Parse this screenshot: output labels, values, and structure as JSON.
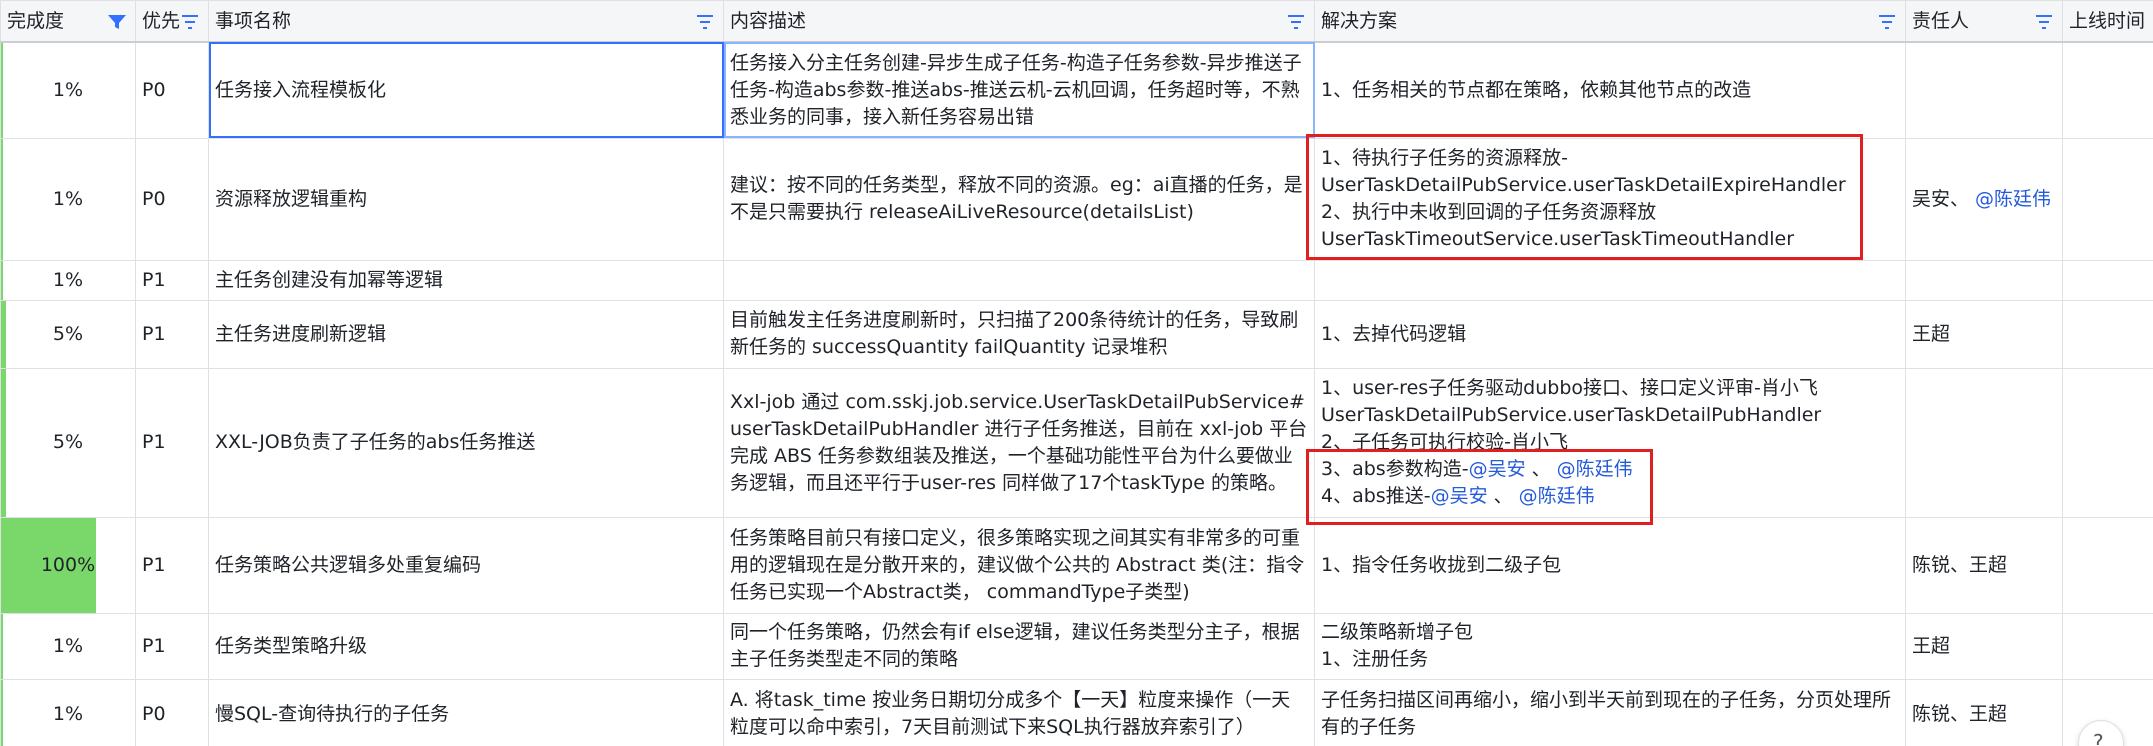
{
  "columns": [
    {
      "label": "完成度",
      "filter": true,
      "active": true
    },
    {
      "label": "优先",
      "filter": true
    },
    {
      "label": "事项名称",
      "filter": true
    },
    {
      "label": "内容描述",
      "filter": true
    },
    {
      "label": "解决方案",
      "filter": true
    },
    {
      "label": "责任人",
      "filter": true
    },
    {
      "label": "上线时间",
      "filter": false
    }
  ],
  "rows": [
    {
      "progress": "1%",
      "progress_value": 0.01,
      "priority": "P0",
      "name": "任务接入流程模板化",
      "desc": "任务接入分主任务创建-异步生成子任务-构造子任务参数-异步推送子任务-构造abs参数-推送abs-推送云机-云机回调，任务超时等，不熟悉业务的同事，接入新任务容易出错",
      "solution": [
        "1、任务相关的节点都在策略，依赖其他节点的改造"
      ],
      "owner": []
    },
    {
      "progress": "1%",
      "progress_value": 0.01,
      "priority": "P0",
      "name": "资源释放逻辑重构",
      "desc": "建议：按不同的任务类型，释放不同的资源。eg：ai直播的任务，是不是只需要执行 releaseAiLiveResource(detailsList)",
      "solution": [
        "1、待执行子任务的资源释放-",
        "UserTaskDetailPubService.userTaskDetailExpireHandler",
        "2、执行中未收到回调的子任务资源释放",
        "UserTaskTimeoutService.userTaskTimeoutHandler"
      ],
      "owner": [
        "吴安、",
        "@陈廷伟"
      ]
    },
    {
      "progress": "1%",
      "progress_value": 0.01,
      "priority": "P1",
      "name": "主任务创建没有加幂等逻辑",
      "desc": "",
      "solution": [],
      "owner": []
    },
    {
      "progress": "5%",
      "progress_value": 0.05,
      "priority": "P1",
      "name": "主任务进度刷新逻辑",
      "desc": "目前触发主任务进度刷新时，只扫描了200条待统计的任务，导致刷新任务的 successQuantity  failQuantity 记录堆积",
      "solution": [
        "1、去掉代码逻辑"
      ],
      "owner": [
        "王超"
      ]
    },
    {
      "progress": "5%",
      "progress_value": 0.05,
      "priority": "P1",
      "name": "XXL-JOB负责了子任务的abs任务推送",
      "desc": "Xxl-job 通过 com.sskj.job.service.UserTaskDetailPubService#userTaskDetailPubHandler 进行子任务推送，目前在 xxl-job 平台完成 ABS 任务参数组装及推送，一个基础功能性平台为什么要做业务逻辑，而且还平行于user-res 同样做了17个taskType 的策略。",
      "solution": [
        "1、user-res子任务驱动dubbo接口、接口定义评审-肖小飞",
        "UserTaskDetailPubService.userTaskDetailPubHandler",
        "2、子任务可执行校验-肖小飞"
      ],
      "solution_mentions": [
        {
          "prefix": "3、abs参数构造-",
          "m1": "@吴安",
          "sep": " 、",
          "m2": "@陈廷伟"
        },
        {
          "prefix": "4、abs推送-",
          "m1": "@吴安",
          "sep": " 、",
          "m2": "@陈廷伟"
        }
      ],
      "owner": []
    },
    {
      "progress": "100%",
      "progress_value": 1.0,
      "priority": "P1",
      "name": "任务策略公共逻辑多处重复编码",
      "desc": "任务策略目前只有接口定义，很多策略实现之间其实有非常多的可重用的逻辑现在是分散开来的，建议做个公共的 Abstract 类(注：指令任务已实现一个Abstract类， commandType子类型)",
      "solution": [
        "1、指令任务收拢到二级子包"
      ],
      "owner": [
        "陈锐、王超"
      ]
    },
    {
      "progress": "1%",
      "progress_value": 0.01,
      "priority": "P1",
      "name": "任务类型策略升级",
      "desc": "同一个任务策略，仍然会有if else逻辑，建议任务类型分主子，根据主子任务类型走不同的策略",
      "solution": [
        "二级策略新增子包",
        "1、注册任务"
      ],
      "owner": [
        "王超"
      ]
    },
    {
      "progress": "1%",
      "progress_value": 0.01,
      "priority": "P0",
      "name": "慢SQL-查询待执行的子任务",
      "desc": "A. 将task_time 按业务日期切分成多个【一天】粒度来操作（一天粒度可以命中索引，7天目前测试下来SQL执行器放弃索引了）",
      "solution": [
        "子任务扫描区间再缩小，缩小到半天前到现在的子任务，分页处理所有的子任务"
      ],
      "owner": [
        "陈锐、王超"
      ]
    }
  ],
  "colors": {
    "accent": "#3370ff",
    "progress_fill": "#7ad86a",
    "highlight": "#e02020",
    "mention": "#245bdb"
  }
}
